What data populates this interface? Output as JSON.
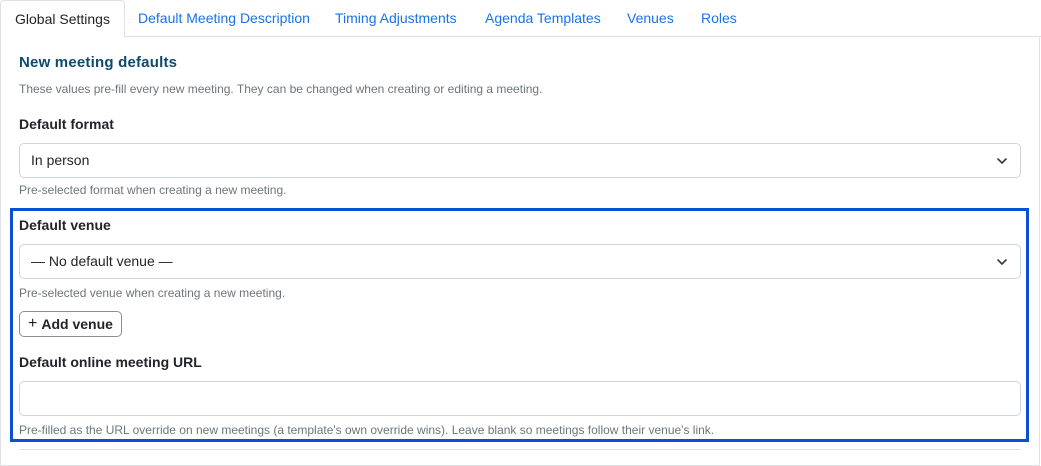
{
  "tabs": [
    {
      "label": "Global Settings",
      "active": true
    },
    {
      "label": "Default Meeting Description",
      "active": false
    },
    {
      "label": "Timing Adjustments",
      "active": false
    },
    {
      "label": "Agenda Templates",
      "active": false
    },
    {
      "label": "Venues",
      "active": false
    },
    {
      "label": "Roles",
      "active": false
    }
  ],
  "section": {
    "title": "New meeting defaults",
    "description": "These values pre-fill every new meeting. They can be changed when creating or editing a meeting."
  },
  "format": {
    "label": "Default format",
    "value": "In person",
    "help": "Pre-selected format when creating a new meeting."
  },
  "venue": {
    "label": "Default venue",
    "value": "— No default venue —",
    "help": "Pre-selected venue when creating a new meeting.",
    "add_button": "Add venue"
  },
  "online_url": {
    "label": "Default online meeting URL",
    "value": "",
    "placeholder": "",
    "help": "Pre-filled as the URL override on new meetings (a template's own override wins). Leave blank so meetings follow their venue's link."
  },
  "colors": {
    "link": "#1a73e8",
    "section_title": "#0e4a6e",
    "highlight_border": "#0a4fd6"
  },
  "icons": {
    "select_chevron": "chevron-down-icon",
    "add": "plus-icon"
  }
}
